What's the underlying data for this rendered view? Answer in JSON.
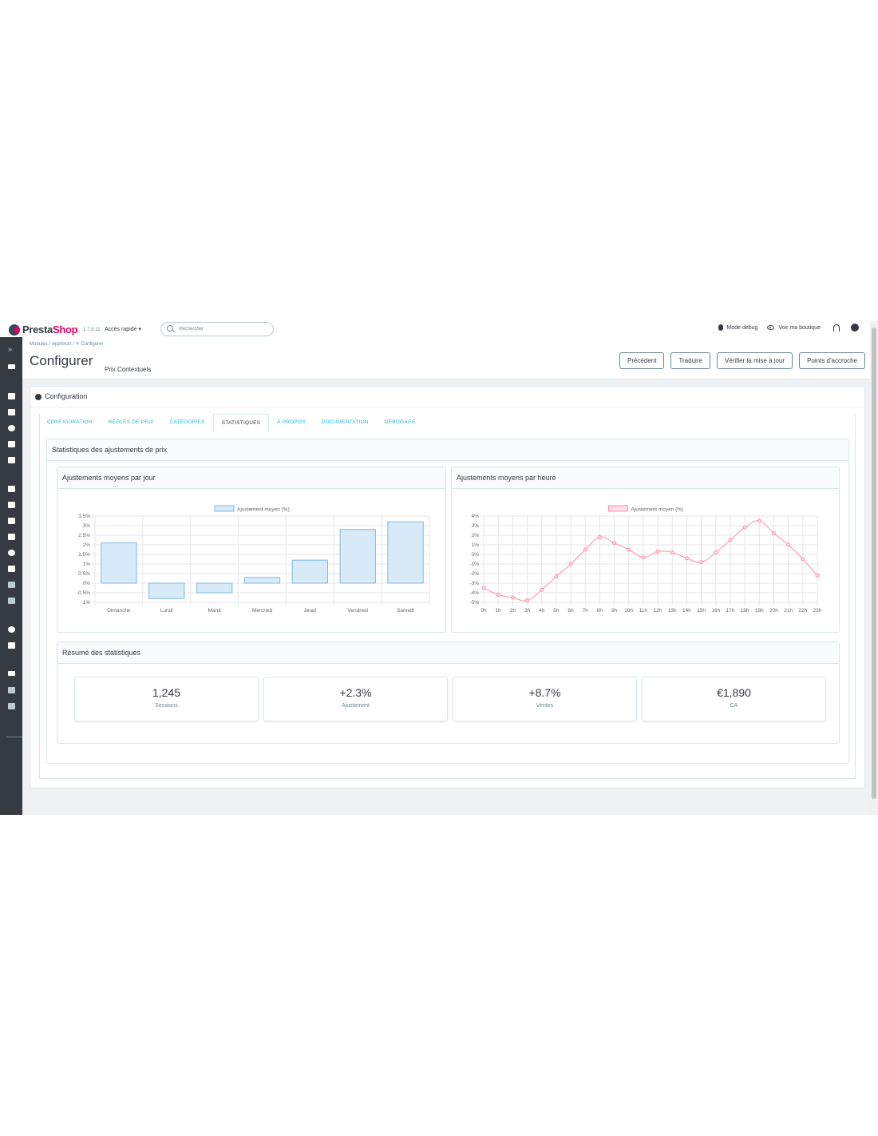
{
  "header": {
    "logo_part1": "Presta",
    "logo_part2": "Shop",
    "version": "1.7.8.11",
    "quick_access": "Accès rapide ▾",
    "search_placeholder": "Rechercher",
    "debug_mode": "Mode debug",
    "view_shop": "Voir ma boutique"
  },
  "breadcrumb": "Modules  /  wpprixctx  /  ✎ Configurer",
  "page": {
    "title": "Configurer",
    "subtitle": "Prix Contextuels"
  },
  "toolbar": {
    "previous": "Précédent",
    "translate": "Traduire",
    "check_update": "Vérifier la mise à jour",
    "hooks": "Points d'accroche"
  },
  "panel": {
    "title": "Configuration"
  },
  "tabs": [
    {
      "label": "Configuration"
    },
    {
      "label": "Règles de prix"
    },
    {
      "label": "Catégories"
    },
    {
      "label": "Statistiques"
    },
    {
      "label": "À propos"
    },
    {
      "label": "Documentation"
    },
    {
      "label": "Débogage"
    }
  ],
  "stats": {
    "title": "Statistiques des ajustements de prix",
    "daily_title": "Ajustements moyens par jour",
    "hourly_title": "Ajustements moyens par heure",
    "summary_title": "Résumé des statistiques",
    "cards": [
      {
        "value": "1,245",
        "label": "Sessions"
      },
      {
        "value": "+2.3%",
        "label": "Ajustement"
      },
      {
        "value": "+8.7%",
        "label": "Ventes"
      },
      {
        "value": "€1,890",
        "label": "CA"
      }
    ]
  },
  "chart_data": [
    {
      "type": "bar",
      "legend": "Ajustement moyen (%)",
      "categories": [
        "Dimanche",
        "Lundi",
        "Mardi",
        "Mercredi",
        "Jeudi",
        "Vendredi",
        "Samedi"
      ],
      "series": [
        {
          "name": "Ajustement moyen (%)",
          "values": [
            2.1,
            -0.8,
            -0.5,
            0.3,
            1.2,
            2.8,
            3.2
          ]
        }
      ],
      "yticks": [
        "-1%",
        "-0.5%",
        "0%",
        "0.5%",
        "1%",
        "1.5%",
        "2%",
        "2.5%",
        "3%",
        "3.5%"
      ],
      "ylim": [
        -1,
        3.5
      ],
      "color": "#d6eaf8",
      "border": "#7fb8e0",
      "grid": true
    },
    {
      "type": "line",
      "legend": "Ajustement moyen (%)",
      "categories": [
        "0h",
        "1h",
        "2h",
        "3h",
        "4h",
        "5h",
        "6h",
        "7h",
        "8h",
        "9h",
        "10h",
        "11h",
        "12h",
        "13h",
        "14h",
        "15h",
        "16h",
        "17h",
        "18h",
        "19h",
        "20h",
        "21h",
        "22h",
        "23h"
      ],
      "series": [
        {
          "name": "Ajustement moyen (%)",
          "values": [
            -3.5,
            -4.2,
            -4.5,
            -4.8,
            -3.7,
            -2.3,
            -1.0,
            0.5,
            1.8,
            1.2,
            0.5,
            -0.3,
            0.3,
            0.2,
            -0.4,
            -0.8,
            0.2,
            1.5,
            2.8,
            3.5,
            2.2,
            1.0,
            -0.5,
            -2.2
          ]
        }
      ],
      "yticks": [
        "-5%",
        "-4%",
        "-3%",
        "-2%",
        "-1%",
        "0%",
        "1%",
        "2%",
        "3%",
        "4%"
      ],
      "ylim": [
        -5,
        4
      ],
      "color": "#ff8fa8",
      "grid": true
    }
  ]
}
